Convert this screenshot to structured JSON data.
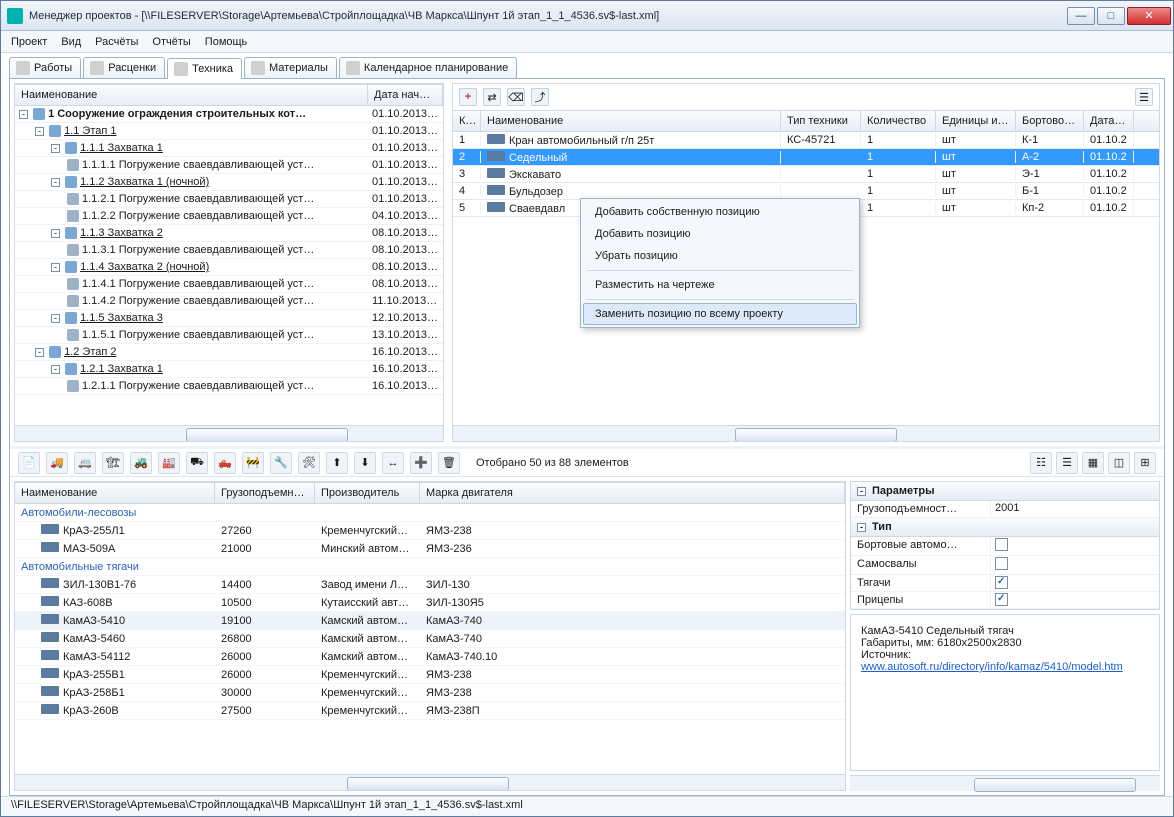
{
  "window": {
    "title": "Менеджер проектов - [\\\\FILESERVER\\Storage\\Артемьева\\Стройплощадка\\ЧВ Маркса\\Шпунт 1й этап_1_1_4536.sv$-last.xml]",
    "min": "—",
    "max": "□",
    "close": "✕"
  },
  "menu": {
    "items": [
      "Проект",
      "Вид",
      "Расчёты",
      "Отчёты",
      "Помощь"
    ]
  },
  "tabs": [
    {
      "label": "Работы"
    },
    {
      "label": "Расценки"
    },
    {
      "label": "Техника",
      "active": true
    },
    {
      "label": "Материалы"
    },
    {
      "label": "Календарное планирование"
    }
  ],
  "tree": {
    "col_name": "Наименование",
    "col_date": "Дата начала",
    "rows": [
      {
        "indent": 0,
        "exp": "-",
        "bold": true,
        "label": "1 Сооружение ограждения строительных кот…",
        "date": "01.10.2013…"
      },
      {
        "indent": 1,
        "exp": "-",
        "under": true,
        "label": "1.1 Этап 1",
        "date": "01.10.2013…"
      },
      {
        "indent": 2,
        "exp": "-",
        "under": true,
        "label": "1.1.1 Захватка 1",
        "date": "01.10.2013…"
      },
      {
        "indent": 3,
        "pen": true,
        "label": "1.1.1.1 Погружение сваевдавливающей уст…",
        "date": "01.10.2013…"
      },
      {
        "indent": 2,
        "exp": "-",
        "under": true,
        "label": "1.1.2 Захватка 1 (ночной)",
        "date": "01.10.2013…"
      },
      {
        "indent": 3,
        "pen": true,
        "label": "1.1.2.1 Погружение сваевдавливающей уст…",
        "date": "01.10.2013…"
      },
      {
        "indent": 3,
        "pen": true,
        "label": "1.1.2.2 Погружение сваевдавливающей уст…",
        "date": "04.10.2013…"
      },
      {
        "indent": 2,
        "exp": "-",
        "under": true,
        "label": "1.1.3 Захватка 2",
        "date": "08.10.2013…"
      },
      {
        "indent": 3,
        "pen": true,
        "label": "1.1.3.1 Погружение сваевдавливающей уст…",
        "date": "08.10.2013…"
      },
      {
        "indent": 2,
        "exp": "-",
        "under": true,
        "label": "1.1.4 Захватка 2 (ночной)",
        "date": "08.10.2013…"
      },
      {
        "indent": 3,
        "pen": true,
        "label": "1.1.4.1 Погружение сваевдавливающей уст…",
        "date": "08.10.2013…"
      },
      {
        "indent": 3,
        "pen": true,
        "label": "1.1.4.2 Погружение сваевдавливающей уст…",
        "date": "11.10.2013…"
      },
      {
        "indent": 2,
        "exp": "-",
        "under": true,
        "label": "1.1.5 Захватка 3",
        "date": "12.10.2013…"
      },
      {
        "indent": 3,
        "pen": true,
        "label": "1.1.5.1 Погружение сваевдавливающей уст…",
        "date": "13.10.2013…"
      },
      {
        "indent": 1,
        "exp": "-",
        "under": true,
        "label": "1.2 Этап 2",
        "date": "16.10.2013…"
      },
      {
        "indent": 2,
        "exp": "-",
        "under": true,
        "label": "1.2.1 Захватка 1",
        "date": "16.10.2013…"
      },
      {
        "indent": 3,
        "pen": true,
        "label": "1.2.1.1 Погружение сваевдавливающей уст…",
        "date": "16.10.2013…"
      }
    ]
  },
  "equip_grid": {
    "col_k": "К…",
    "col_name": "Наименование",
    "col_type": "Тип техники",
    "col_qty": "Количество",
    "col_unit": "Единицы измерения",
    "col_board": "Бортовой номер",
    "col_start": "Дата начала",
    "rows": [
      {
        "n": "1",
        "name": "Кран автомобильный г/п 25т",
        "type": "КС-45721",
        "qty": "1",
        "unit": "шт",
        "board": "К-1",
        "start": "01.10.2"
      },
      {
        "n": "2",
        "name": "Седельный",
        "type": "",
        "qty": "1",
        "unit": "шт",
        "board": "А-2",
        "start": "01.10.2",
        "selected": true
      },
      {
        "n": "3",
        "name": "Экскавато",
        "type": "",
        "qty": "1",
        "unit": "шт",
        "board": "Э-1",
        "start": "01.10.2"
      },
      {
        "n": "4",
        "name": "Бульдозер",
        "type": "",
        "qty": "1",
        "unit": "шт",
        "board": "Б-1",
        "start": "01.10.2"
      },
      {
        "n": "5",
        "name": "Сваевдавл",
        "type": "",
        "qty": "1",
        "unit": "шт",
        "board": "Кп-2",
        "start": "01.10.2"
      }
    ]
  },
  "context_menu": {
    "items": [
      "Добавить собственную позицию",
      "Добавить позицию",
      "Убрать позицию",
      "---",
      "Разместить на чертеже",
      "---",
      "Заменить позицию по всему проекту"
    ],
    "highlight": 6
  },
  "filter": {
    "status": "Отобрано 50 из 88 элементов"
  },
  "catalog": {
    "col_name": "Наименование",
    "col_load": "Грузоподъемн…",
    "col_maker": "Производитель",
    "col_engine": "Марка двигателя",
    "group1": "Автомобили-лесовозы",
    "group2": "Автомобильные тягачи",
    "rows1": [
      {
        "name": "КрАЗ-255Л1",
        "load": "27260",
        "maker": "Кременчугский…",
        "engine": "ЯМЗ-238"
      },
      {
        "name": "МАЗ-509А",
        "load": "21000",
        "maker": "Минский автом…",
        "engine": "ЯМЗ-236"
      }
    ],
    "rows2": [
      {
        "name": "ЗИЛ-130В1-76",
        "load": "14400",
        "maker": "Завод имени Л…",
        "engine": "ЗИЛ-130"
      },
      {
        "name": "КАЗ-608В",
        "load": "10500",
        "maker": "Кутаисский авт…",
        "engine": "ЗИЛ-130Я5"
      },
      {
        "name": "КамАЗ-5410",
        "load": "19100",
        "maker": "Камский автом…",
        "engine": "КамАЗ-740",
        "hl": true
      },
      {
        "name": "КамАЗ-5460",
        "load": "26800",
        "maker": "Камский автом…",
        "engine": "КамАЗ-740"
      },
      {
        "name": "КамАЗ-54112",
        "load": "26000",
        "maker": "Камский автом…",
        "engine": "КамАЗ-740.10"
      },
      {
        "name": "КрАЗ-255В1",
        "load": "26000",
        "maker": "Кременчугский…",
        "engine": "ЯМЗ-238"
      },
      {
        "name": "КрАЗ-258Б1",
        "load": "30000",
        "maker": "Кременчугский…",
        "engine": "ЯМЗ-238"
      },
      {
        "name": "КрАЗ-260В",
        "load": "27500",
        "maker": "Кременчугский…",
        "engine": "ЯМЗ-238П"
      }
    ]
  },
  "params": {
    "head1": "Параметры",
    "load_key": "Грузоподъемност…",
    "load_val": "2001",
    "head2": "Тип",
    "type_rows": [
      {
        "k": "Бортовые автомо…",
        "checked": false
      },
      {
        "k": "Самосвалы",
        "checked": false
      },
      {
        "k": "Тягачи",
        "checked": true
      },
      {
        "k": "Прицепы",
        "checked": true
      }
    ],
    "info_title": "КамАЗ-5410 Седельный тягач",
    "info_dim": "Габариты, мм: 6180x2500x2830",
    "info_src": "Источник:",
    "info_link": "www.autosoft.ru/directory/info/kamaz/5410/model.htm"
  },
  "statusbar": "\\\\FILESERVER\\Storage\\Артемьева\\Стройплощадка\\ЧВ Маркса\\Шпунт 1й этап_1_1_4536.sv$-last.xml"
}
